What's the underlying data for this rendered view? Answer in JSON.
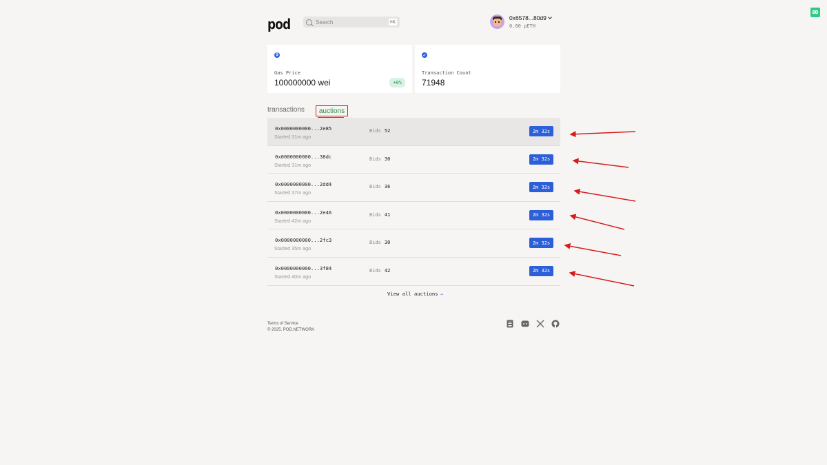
{
  "header": {
    "logo": "pod",
    "search_placeholder": "Search",
    "search_shortcut": "⌘K",
    "account_address": "0x6578...80d9",
    "account_balance": "0.00 pETH"
  },
  "stats": {
    "gas_price_label": "Gas Price",
    "gas_price_value": "100000000 wei",
    "gas_price_change": "+0%",
    "tx_count_label": "Transaction Count",
    "tx_count_value": "71948"
  },
  "tabs": [
    {
      "label": "transactions",
      "active": false
    },
    {
      "label": "auctions",
      "active": true
    }
  ],
  "auctions": [
    {
      "id": "0x0000000000...2e85",
      "started": "Started 31m ago",
      "bids_label": "Bids",
      "bids": "52",
      "timer": "2m 32s"
    },
    {
      "id": "0x0000000000...38dc",
      "started": "Started 31m ago",
      "bids_label": "Bids",
      "bids": "30",
      "timer": "2m 32s"
    },
    {
      "id": "0x0000000000...2dd4",
      "started": "Started 37m ago",
      "bids_label": "Bids",
      "bids": "36",
      "timer": "2m 32s"
    },
    {
      "id": "0x0000000000...2e46",
      "started": "Started 42m ago",
      "bids_label": "Bids",
      "bids": "41",
      "timer": "2m 32s"
    },
    {
      "id": "0x0000000000...2fc3",
      "started": "Started 35m ago",
      "bids_label": "Bids",
      "bids": "30",
      "timer": "2m 32s"
    },
    {
      "id": "0x0000000000...3f84",
      "started": "Started 40m ago",
      "bids_label": "Bids",
      "bids": "42",
      "timer": "2m 32s"
    }
  ],
  "view_all_label": "View all auctions",
  "view_all_arrow": "→",
  "footer": {
    "terms": "Terms of Service",
    "copyright": "© 2025, POD.NETWORK"
  },
  "social_icons": [
    "docs-icon",
    "discord-icon",
    "x-icon",
    "github-icon"
  ],
  "colors": {
    "accent_blue": "#2d5fd8",
    "accent_green": "#2a8a46",
    "annotation_red": "#d41c1c"
  }
}
